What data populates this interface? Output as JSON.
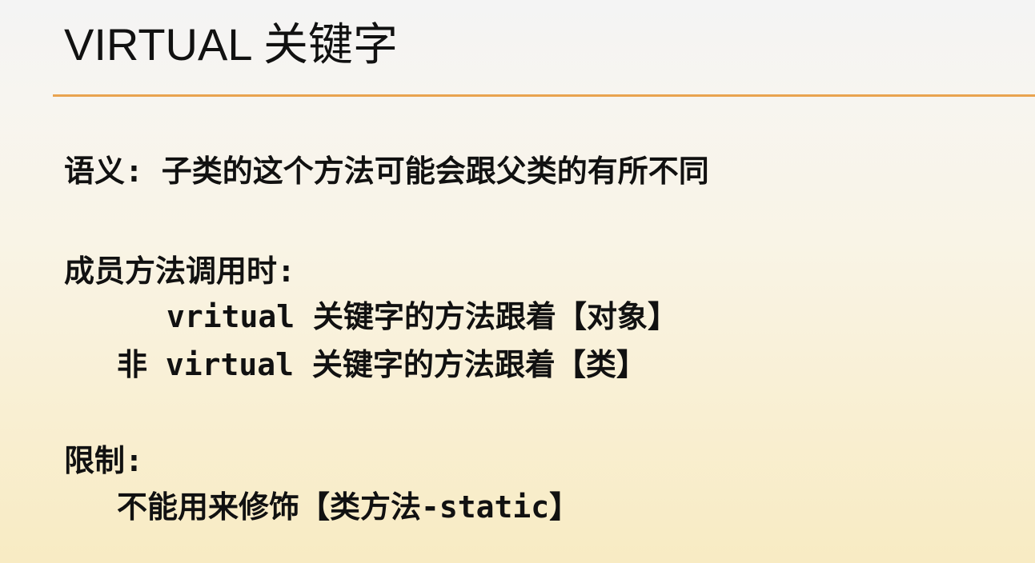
{
  "slide": {
    "title": "VIRTUAL 关键字",
    "semantics": "语义: 子类的这个方法可能会跟父类的有所不同",
    "member_call": {
      "heading": "成员方法调用时:",
      "virtual_line": "vritual 关键字的方法跟着【对象】",
      "non_virtual_line": "非 virtual 关键字的方法跟着【类】"
    },
    "limits": {
      "heading": "限制:",
      "item": "不能用来修饰【类方法-static】"
    }
  },
  "colors": {
    "accent_rule": "#e9a34f",
    "text": "#111111"
  }
}
